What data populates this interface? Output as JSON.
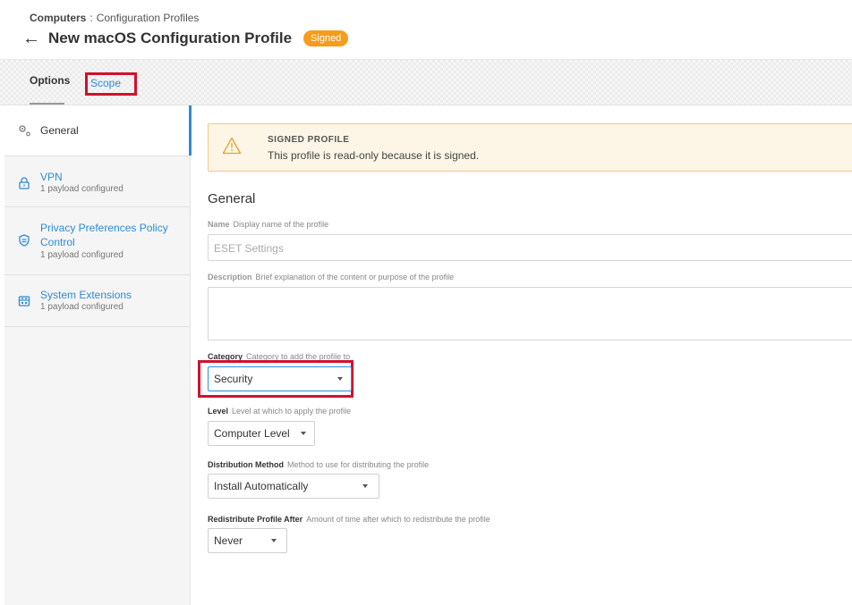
{
  "breadcrumb": {
    "root": "Computers",
    "separator": ":",
    "current": "Configuration Profiles"
  },
  "header": {
    "back_icon": "arrow-left-icon",
    "title": "New macOS Configuration Profile",
    "badge": "Signed"
  },
  "tabs": [
    {
      "label": "Options",
      "active": true
    },
    {
      "label": "Scope",
      "active": false
    }
  ],
  "sidebar": {
    "items": [
      {
        "icon": "gear-icon",
        "label": "General",
        "sub": ""
      },
      {
        "icon": "lock-icon",
        "label": "VPN",
        "sub": "1 payload configured"
      },
      {
        "icon": "shield-icon",
        "label_line1": "Privacy Preferences Policy",
        "label_line2": "Control",
        "sub": "1 payload configured"
      },
      {
        "icon": "extension-icon",
        "label": "System Extensions",
        "sub": "1 payload configured"
      }
    ]
  },
  "alert": {
    "icon": "warning-icon",
    "title": "SIGNED PROFILE",
    "text": "This profile is read-only because it is signed."
  },
  "section_title": "General",
  "fields": {
    "name": {
      "label": "Name",
      "help": "Display name of the profile",
      "value": "ESET Settings"
    },
    "description": {
      "label": "Description",
      "help": "Brief explanation of the content or purpose of the profile",
      "value": ""
    },
    "category": {
      "label": "Category",
      "help": "Category to add the profile to",
      "value": "Security"
    },
    "level": {
      "label": "Level",
      "help": "Level at which to apply the profile",
      "value": "Computer Level"
    },
    "distribution": {
      "label": "Distribution Method",
      "help": "Method to use for distributing the profile",
      "value": "Install Automatically"
    },
    "redistribute": {
      "label": "Redistribute Profile After",
      "help": "Amount of time after which to redistribute the profile",
      "value": "Never"
    }
  },
  "colors": {
    "accent": "#2e8bd4",
    "badge": "#f59d1b",
    "highlight": "#d0112b",
    "alert_bg": "#fdf6e7"
  }
}
